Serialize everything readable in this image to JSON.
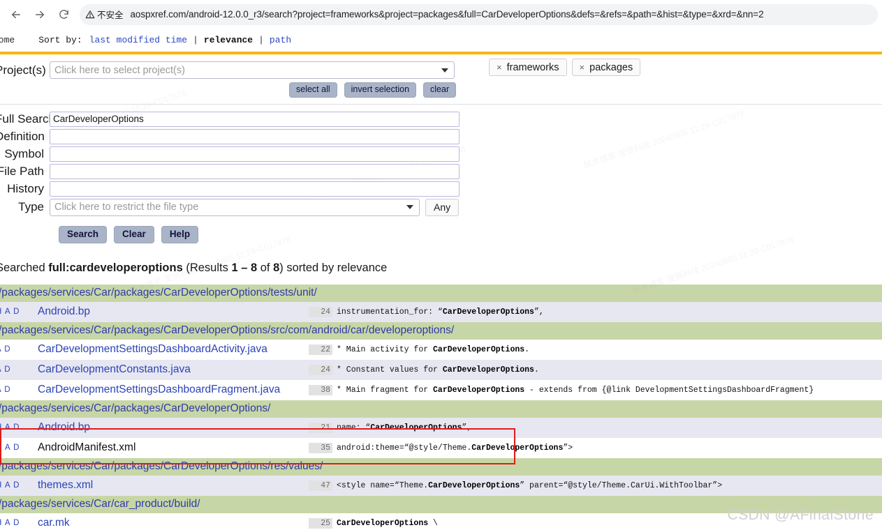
{
  "browser": {
    "back_icon": "arrow-left-icon",
    "forward_icon": "arrow-right-icon",
    "reload_icon": "reload-icon",
    "security_label": "不安全",
    "security_icon": "warning-triangle-icon",
    "url": "aospxref.com/android-12.0.0_r3/search?project=frameworks&project=packages&full=CarDeveloperOptions&defs=&refs=&path=&hist=&type=&xrd=&nn=2"
  },
  "site_header": {
    "home_label": "Home",
    "sort_label": "Sort by:",
    "sort_options": [
      {
        "label": "last modified time",
        "current": false
      },
      {
        "label": "relevance",
        "current": true
      },
      {
        "label": "path",
        "current": false
      }
    ],
    "separator": "|",
    "accent_bar_color": "#f7b500"
  },
  "search_form": {
    "project_label": "Project(s)",
    "project_placeholder": "Click here to select project(s)",
    "project_chips": [
      {
        "remove_icon": "x-icon",
        "label": "frameworks"
      },
      {
        "remove_icon": "x-icon",
        "label": "packages"
      }
    ],
    "selection_buttons": [
      {
        "label": "select all"
      },
      {
        "label": "invert selection"
      },
      {
        "label": "clear"
      }
    ],
    "fields": [
      {
        "label": "Full Search",
        "value": "CarDeveloperOptions",
        "placeholder": ""
      },
      {
        "label": "Definition",
        "value": "",
        "placeholder": ""
      },
      {
        "label": "Symbol",
        "value": "",
        "placeholder": ""
      },
      {
        "label": "File Path",
        "value": "",
        "placeholder": ""
      },
      {
        "label": "History",
        "value": "",
        "placeholder": ""
      }
    ],
    "type_label": "Type",
    "type_placeholder": "Click here to restrict the file type",
    "type_any_label": "Any",
    "action_buttons": [
      {
        "label": "Search"
      },
      {
        "label": "Clear"
      },
      {
        "label": "Help"
      }
    ]
  },
  "results_summary": {
    "prefix": "Searched ",
    "query": "full:cardeveloperoptions",
    "results_open": " (Results ",
    "range": "1 – 8",
    "of": " of ",
    "total": "8",
    "suffix": ") sorted by relevance"
  },
  "results": [
    {
      "type": "dir",
      "path": "/packages/services/Car/packages/CarDeveloperOptions/tests/unit/"
    },
    {
      "type": "file",
      "actions": "H A D",
      "name": "Android.bp",
      "is_link": true,
      "lineno": "24",
      "snippet_pre": "instrumentation_for: “",
      "snippet_match": "CarDeveloperOptions",
      "snippet_post": "”,",
      "shade": "alt"
    },
    {
      "type": "dir",
      "path": "/packages/services/Car/packages/CarDeveloperOptions/src/com/android/car/developeroptions/"
    },
    {
      "type": "file",
      "actions": "A D",
      "name": "CarDevelopmentSettingsDashboardActivity.java",
      "is_link": true,
      "lineno": "22",
      "snippet_pre": "* Main activity for ",
      "snippet_match": "CarDeveloperOptions",
      "snippet_post": ".",
      "shade": "white"
    },
    {
      "type": "file",
      "actions": "A D",
      "name": "CarDevelopmentConstants.java",
      "is_link": true,
      "lineno": "24",
      "snippet_pre": "* Constant values for ",
      "snippet_match": "CarDeveloperOptions",
      "snippet_post": ".",
      "shade": "alt"
    },
    {
      "type": "file",
      "actions": "A D",
      "name": "CarDevelopmentSettingsDashboardFragment.java",
      "is_link": true,
      "lineno": "38",
      "snippet_pre": "* Main fragment for ",
      "snippet_match": "CarDeveloperOptions",
      "snippet_post": " - extends from {@link DevelopmentSettingsDashboardFragment}",
      "shade": "white"
    },
    {
      "type": "dir",
      "path": "/packages/services/Car/packages/CarDeveloperOptions/"
    },
    {
      "type": "file",
      "actions": "H A D",
      "name": "Android.bp",
      "is_link": true,
      "lineno": "21",
      "snippet_pre": "name: “",
      "snippet_match": "CarDeveloperOptions",
      "snippet_post": "”,",
      "shade": "alt"
    },
    {
      "type": "file",
      "actions": "H A D",
      "name": "AndroidManifest.xml",
      "is_link": false,
      "lineno": "35",
      "snippet_pre": "android:theme=“@style/Theme.",
      "snippet_match": "CarDeveloperOptions",
      "snippet_post": "”>",
      "shade": "white"
    },
    {
      "type": "dir",
      "path": "/packages/services/Car/packages/CarDeveloperOptions/res/values/"
    },
    {
      "type": "file",
      "actions": "H A D",
      "name": "themes.xml",
      "is_link": true,
      "lineno": "47",
      "snippet_pre": "<style name=“Theme.",
      "snippet_match": "CarDeveloperOptions",
      "snippet_post": "” parent=“@style/Theme.CarUi.WithToolbar”>",
      "shade": "alt"
    },
    {
      "type": "dir",
      "path": "/packages/services/Car/car_product/build/"
    },
    {
      "type": "file",
      "actions": "H A D",
      "name": "car.mk",
      "is_link": true,
      "lineno": "25",
      "snippet_pre": "",
      "snippet_match": "CarDeveloperOptions",
      "snippet_post": " \\",
      "shade": "white"
    }
  ],
  "highlight": {
    "color": "#e01b1b"
  },
  "watermark": {
    "text": "CSDN @AFinalStone"
  },
  "colors": {
    "dir_row_bg": "#c7d6a6",
    "alt_row_bg": "#e7e7f2",
    "link": "#2b43b8",
    "accent_bar": "#f7b500"
  }
}
